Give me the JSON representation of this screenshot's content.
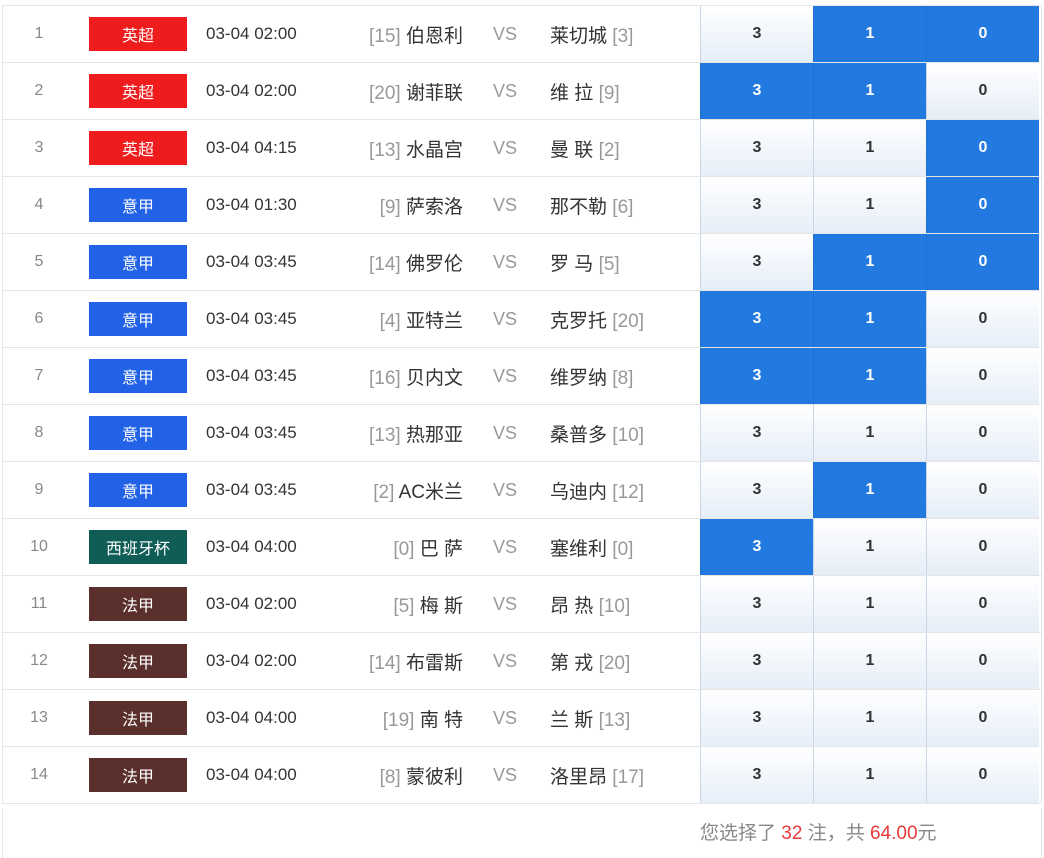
{
  "colors": {
    "epl": "#ee1c1c",
    "seriea": "#2262e6",
    "copa": "#0f5d55",
    "ligue1": "#5b2f2c",
    "selected": "#2279df"
  },
  "vs_label": "VS",
  "matches": [
    {
      "idx": "1",
      "league": "英超",
      "league_color": "#ee1c1c",
      "time": "03-04 02:00",
      "home_rank": "[15]",
      "home": "伯恩利",
      "away": "莱切城",
      "away_rank": "[3]",
      "odds": [
        "3",
        "1",
        "0"
      ],
      "selected": [
        false,
        true,
        true
      ]
    },
    {
      "idx": "2",
      "league": "英超",
      "league_color": "#ee1c1c",
      "time": "03-04 02:00",
      "home_rank": "[20]",
      "home": "谢菲联",
      "away": "维 拉",
      "away_rank": "[9]",
      "odds": [
        "3",
        "1",
        "0"
      ],
      "selected": [
        true,
        true,
        false
      ]
    },
    {
      "idx": "3",
      "league": "英超",
      "league_color": "#ee1c1c",
      "time": "03-04 04:15",
      "home_rank": "[13]",
      "home": "水晶宫",
      "away": "曼 联",
      "away_rank": "[2]",
      "odds": [
        "3",
        "1",
        "0"
      ],
      "selected": [
        false,
        false,
        true
      ]
    },
    {
      "idx": "4",
      "league": "意甲",
      "league_color": "#2262e6",
      "time": "03-04 01:30",
      "home_rank": "[9]",
      "home": "萨索洛",
      "away": "那不勒",
      "away_rank": "[6]",
      "odds": [
        "3",
        "1",
        "0"
      ],
      "selected": [
        false,
        false,
        true
      ]
    },
    {
      "idx": "5",
      "league": "意甲",
      "league_color": "#2262e6",
      "time": "03-04 03:45",
      "home_rank": "[14]",
      "home": "佛罗伦",
      "away": "罗 马",
      "away_rank": "[5]",
      "odds": [
        "3",
        "1",
        "0"
      ],
      "selected": [
        false,
        true,
        true
      ]
    },
    {
      "idx": "6",
      "league": "意甲",
      "league_color": "#2262e6",
      "time": "03-04 03:45",
      "home_rank": "[4]",
      "home": "亚特兰",
      "away": "克罗托",
      "away_rank": "[20]",
      "odds": [
        "3",
        "1",
        "0"
      ],
      "selected": [
        true,
        true,
        false
      ]
    },
    {
      "idx": "7",
      "league": "意甲",
      "league_color": "#2262e6",
      "time": "03-04 03:45",
      "home_rank": "[16]",
      "home": "贝内文",
      "away": "维罗纳",
      "away_rank": "[8]",
      "odds": [
        "3",
        "1",
        "0"
      ],
      "selected": [
        true,
        true,
        false
      ]
    },
    {
      "idx": "8",
      "league": "意甲",
      "league_color": "#2262e6",
      "time": "03-04 03:45",
      "home_rank": "[13]",
      "home": "热那亚",
      "away": "桑普多",
      "away_rank": "[10]",
      "odds": [
        "3",
        "1",
        "0"
      ],
      "selected": [
        false,
        false,
        false
      ]
    },
    {
      "idx": "9",
      "league": "意甲",
      "league_color": "#2262e6",
      "time": "03-04 03:45",
      "home_rank": "[2]",
      "home": "AC米兰",
      "away": "乌迪内",
      "away_rank": "[12]",
      "odds": [
        "3",
        "1",
        "0"
      ],
      "selected": [
        false,
        true,
        false
      ]
    },
    {
      "idx": "10",
      "league": "西班牙杯",
      "league_color": "#0f5d55",
      "time": "03-04 04:00",
      "home_rank": "[0]",
      "home": "巴 萨",
      "away": "塞维利",
      "away_rank": "[0]",
      "odds": [
        "3",
        "1",
        "0"
      ],
      "selected": [
        true,
        false,
        false
      ]
    },
    {
      "idx": "11",
      "league": "法甲",
      "league_color": "#5b2f2c",
      "time": "03-04 02:00",
      "home_rank": "[5]",
      "home": "梅 斯",
      "away": "昂 热",
      "away_rank": "[10]",
      "odds": [
        "3",
        "1",
        "0"
      ],
      "selected": [
        false,
        false,
        false
      ]
    },
    {
      "idx": "12",
      "league": "法甲",
      "league_color": "#5b2f2c",
      "time": "03-04 02:00",
      "home_rank": "[14]",
      "home": "布雷斯",
      "away": "第 戎",
      "away_rank": "[20]",
      "odds": [
        "3",
        "1",
        "0"
      ],
      "selected": [
        false,
        false,
        false
      ]
    },
    {
      "idx": "13",
      "league": "法甲",
      "league_color": "#5b2f2c",
      "time": "03-04 04:00",
      "home_rank": "[19]",
      "home": "南 特",
      "away": "兰 斯",
      "away_rank": "[13]",
      "odds": [
        "3",
        "1",
        "0"
      ],
      "selected": [
        false,
        false,
        false
      ]
    },
    {
      "idx": "14",
      "league": "法甲",
      "league_color": "#5b2f2c",
      "time": "03-04 04:00",
      "home_rank": "[8]",
      "home": "蒙彼利",
      "away": "洛里昂",
      "away_rank": "[17]",
      "odds": [
        "3",
        "1",
        "0"
      ],
      "selected": [
        false,
        false,
        false
      ]
    }
  ],
  "summary": {
    "prefix": "您选择了 ",
    "bets": "32",
    "middle": " 注，共 ",
    "amount": "64.00",
    "suffix": "元"
  }
}
